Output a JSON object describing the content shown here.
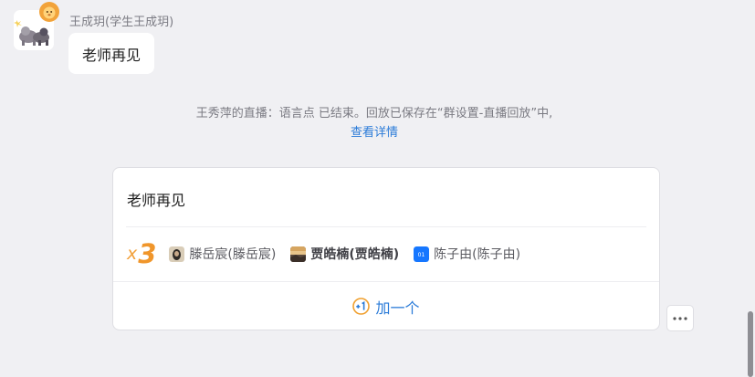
{
  "message": {
    "sender": "王成玥(学生王成玥)",
    "text": "老师再见"
  },
  "notice": {
    "text": "王秀萍的直播：语言点 已结束。回放已保存在“群设置-直播回放”中,",
    "link": "查看详情"
  },
  "repeat_card": {
    "text": "老师再见",
    "count_prefix": "x",
    "count": "3",
    "participants": [
      {
        "name": "滕岳宸(滕岳宸)",
        "bold": false,
        "avatar": "photo-dark"
      },
      {
        "name": "贾皓楠(贾皓楠)",
        "bold": true,
        "avatar": "photo-sunset"
      },
      {
        "name": "陈子由(陈子由)",
        "bold": false,
        "avatar": "blue-tile",
        "avatar_text": "01"
      }
    ],
    "plus_label": "加一个",
    "plus_icon": "plus-one-icon"
  },
  "colors": {
    "accent_blue": "#2b7bd8",
    "count_orange": "#f0962b",
    "background": "#f0f0f3"
  }
}
